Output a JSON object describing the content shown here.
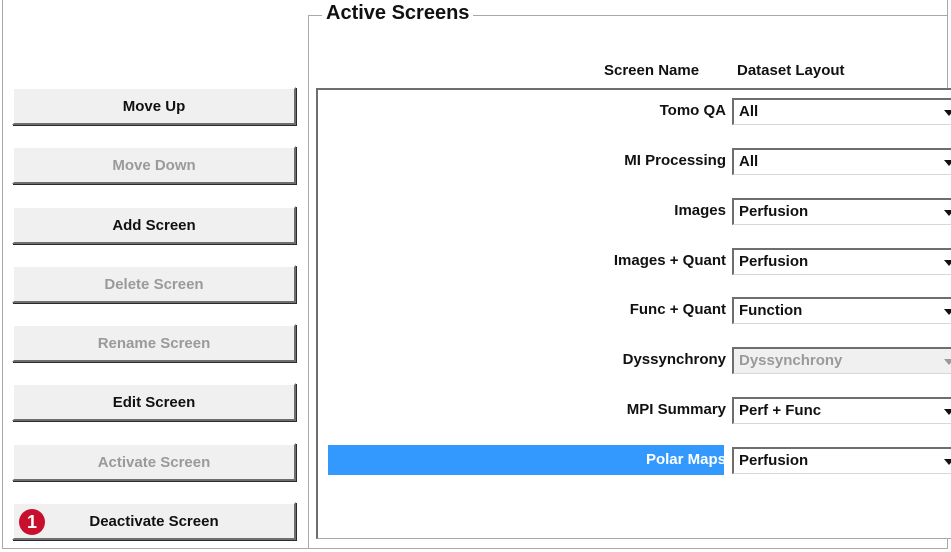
{
  "group_title": "Active Screens",
  "columns": {
    "screen_name": "Screen Name",
    "dataset_layout": "Dataset Layout"
  },
  "buttons": [
    {
      "label": "Move Up",
      "enabled": true
    },
    {
      "label": "Move Down",
      "enabled": false
    },
    {
      "label": "Add Screen",
      "enabled": true
    },
    {
      "label": "Delete Screen",
      "enabled": false
    },
    {
      "label": "Rename Screen",
      "enabled": false
    },
    {
      "label": "Edit Screen",
      "enabled": true
    },
    {
      "label": "Activate Screen",
      "enabled": false
    },
    {
      "label": "Deactivate Screen",
      "enabled": true
    }
  ],
  "badge": "1",
  "screens": [
    {
      "name": "Tomo QA",
      "layout": "All",
      "enabled": true,
      "selected": false
    },
    {
      "name": "MI Processing",
      "layout": "All",
      "enabled": true,
      "selected": false
    },
    {
      "name": "Images",
      "layout": "Perfusion",
      "enabled": true,
      "selected": false
    },
    {
      "name": "Images + Quant",
      "layout": "Perfusion",
      "enabled": true,
      "selected": false
    },
    {
      "name": "Func + Quant",
      "layout": "Function",
      "enabled": true,
      "selected": false
    },
    {
      "name": "Dyssynchrony",
      "layout": "Dyssynchrony",
      "enabled": false,
      "selected": false
    },
    {
      "name": "MPI Summary",
      "layout": "Perf + Func",
      "enabled": true,
      "selected": false
    },
    {
      "name": "Polar Maps",
      "layout": "Perfusion",
      "enabled": true,
      "selected": true
    }
  ],
  "colors": {
    "selection": "#3399ff",
    "badge": "#c8102e",
    "disabled_text": "#9a9a9a"
  }
}
